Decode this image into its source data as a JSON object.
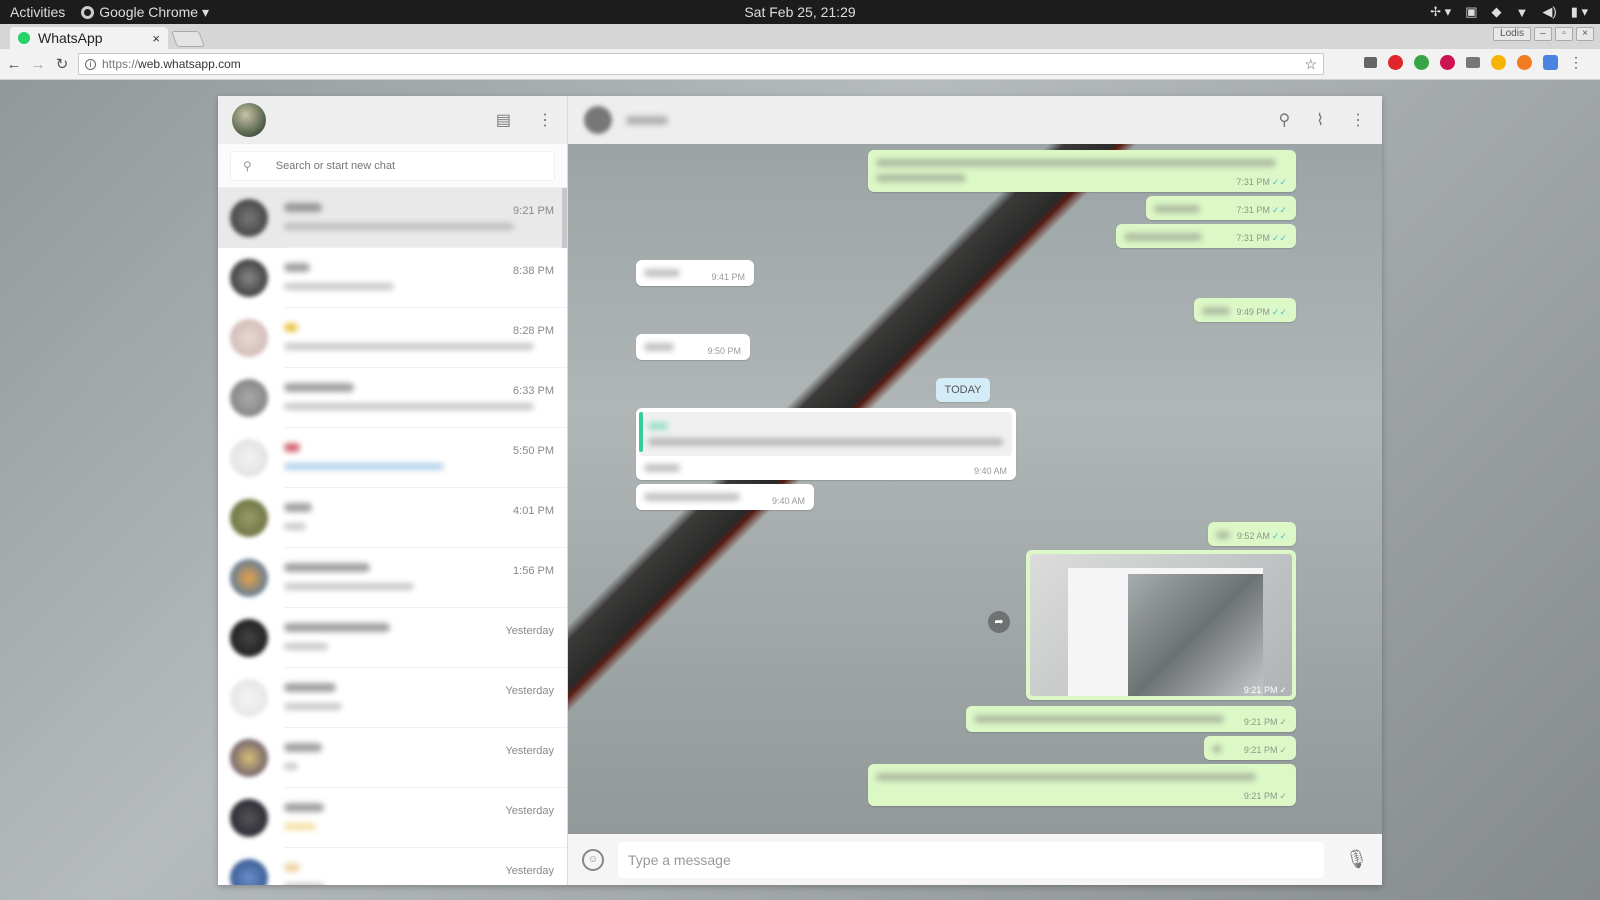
{
  "topbar": {
    "activities": "Activities",
    "app_name": "Google Chrome",
    "clock": "Sat Feb 25, 21:29"
  },
  "browser": {
    "tab_title": "WhatsApp",
    "tab_close": "×",
    "url_scheme": "https://",
    "url_host": "web.whatsapp.com",
    "profile": "Lodis"
  },
  "sidebar": {
    "search_placeholder": "Search or start new chat",
    "chats": [
      {
        "time": "9:21 PM",
        "active": true
      },
      {
        "time": "8:38 PM"
      },
      {
        "time": "8:28 PM"
      },
      {
        "time": "6:33 PM"
      },
      {
        "time": "5:50 PM"
      },
      {
        "time": "4:01 PM"
      },
      {
        "time": "1:56 PM"
      },
      {
        "time": "Yesterday"
      },
      {
        "time": "Yesterday"
      },
      {
        "time": "Yesterday"
      },
      {
        "time": "Yesterday"
      },
      {
        "time": "Yesterday"
      }
    ]
  },
  "conversation": {
    "date_divider": "TODAY",
    "messages": [
      {
        "dir": "out",
        "time": "7:31 PM",
        "ticks": "✓✓"
      },
      {
        "dir": "out",
        "time": "7:31 PM",
        "ticks": "✓✓"
      },
      {
        "dir": "out",
        "time": "7:31 PM",
        "ticks": "✓✓"
      },
      {
        "dir": "in",
        "time": "9:41 PM"
      },
      {
        "dir": "out",
        "time": "9:49 PM",
        "ticks": "✓✓"
      },
      {
        "dir": "in",
        "time": "9:50 PM"
      },
      {
        "dir": "in",
        "time": "9:40 AM"
      },
      {
        "dir": "in",
        "time": "9:40 AM"
      },
      {
        "dir": "out",
        "time": "9:52 AM",
        "ticks": "✓✓"
      },
      {
        "dir": "out",
        "time": "9:21 PM",
        "ticks": "✓"
      },
      {
        "dir": "out",
        "time": "9:21 PM",
        "ticks": "✓"
      },
      {
        "dir": "out",
        "time": "9:21 PM",
        "ticks": "✓"
      },
      {
        "dir": "out",
        "time": "9:21 PM",
        "ticks": "✓"
      }
    ]
  },
  "composer": {
    "placeholder": "Type a message"
  }
}
